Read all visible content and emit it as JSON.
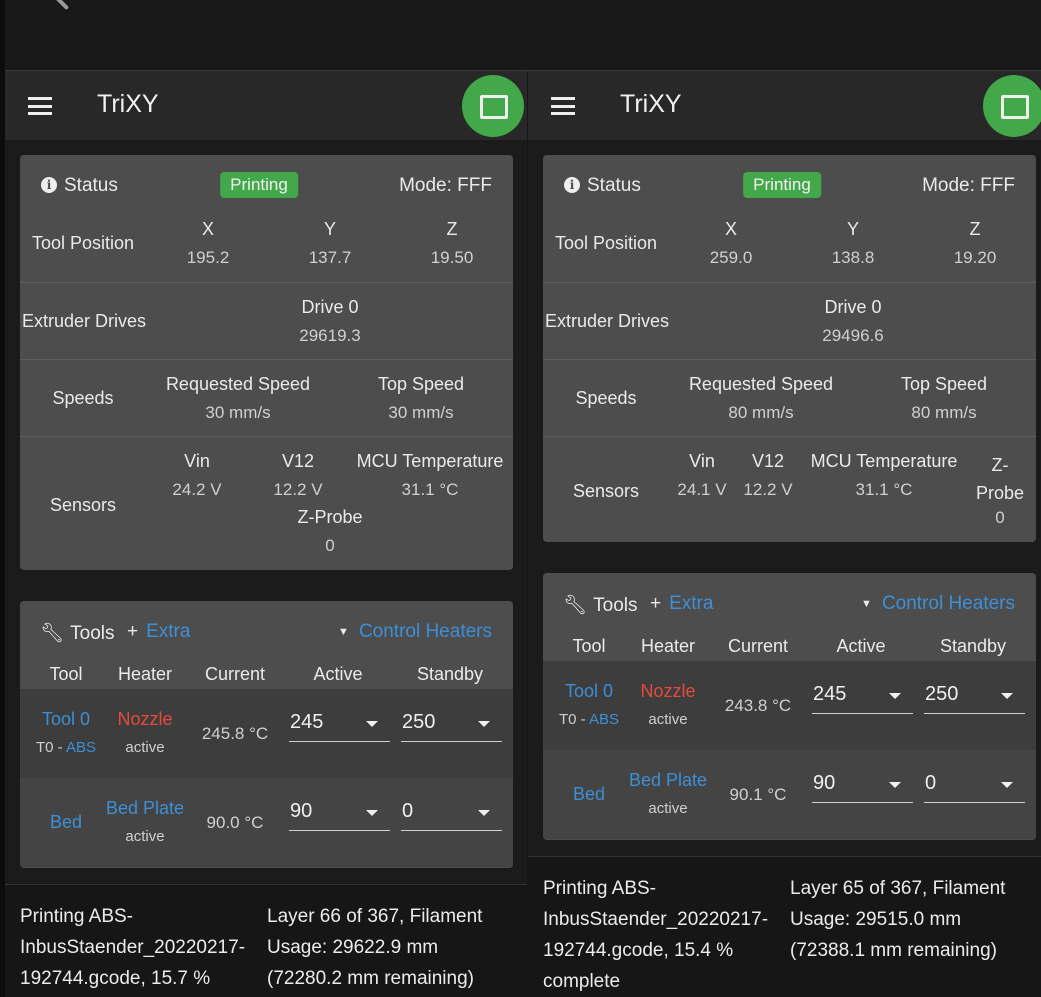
{
  "colors": {
    "accent_green": "#43a84a",
    "link_blue": "#3d8fd6",
    "heater_red": "#e54a3d"
  },
  "icons": {
    "menu": "hamburger-icon",
    "fab": "fullscreen-icon",
    "status": "info-icon",
    "tools": "wrench-icon",
    "extra": "plus-icon",
    "control": "caret-down-icon"
  },
  "screens": [
    {
      "app_title": "TriXY",
      "status": {
        "title": "Status",
        "badge": "Printing",
        "mode": "Mode: FFF",
        "tool_position": {
          "label": "Tool Position",
          "axes": [
            {
              "name": "X",
              "value": "195.2"
            },
            {
              "name": "Y",
              "value": "137.7"
            },
            {
              "name": "Z",
              "value": "19.50"
            }
          ]
        },
        "extruder": {
          "label": "Extruder Drives",
          "drive": "Drive 0",
          "value": "29619.3"
        },
        "speeds": {
          "label": "Speeds",
          "requested_label": "Requested Speed",
          "requested": "30 mm/s",
          "top_label": "Top Speed",
          "top": "30 mm/s"
        },
        "sensors": {
          "label": "Sensors",
          "items": [
            {
              "name": "Vin",
              "value": "24.2 V"
            },
            {
              "name": "V12",
              "value": "12.2 V"
            },
            {
              "name": "MCU Temperature",
              "value": "31.1 °C"
            },
            {
              "name": "Z-Probe",
              "value": "0"
            }
          ]
        }
      },
      "tools": {
        "title": "Tools",
        "extra": "Extra",
        "control": "Control Heaters",
        "headers": [
          "Tool",
          "Heater",
          "Current",
          "Active",
          "Standby"
        ],
        "rows": [
          {
            "tool": "Tool 0",
            "sub_prefix": "T0 - ",
            "sub_link": "ABS",
            "heater": "Nozzle",
            "heater_state": "active",
            "current": "245.8 °C",
            "active": "245",
            "standby": "250"
          },
          {
            "tool": "Bed",
            "sub_prefix": "",
            "sub_link": "",
            "heater": "Bed Plate",
            "heater_state": "active",
            "current": "90.0 °C",
            "active": "90",
            "standby": "0"
          }
        ]
      },
      "footer": {
        "job": "Printing ABS-InbusStaender_20220217-192744.gcode, 15.7 %",
        "progress": "Layer 66 of 367, Filament Usage: 29622.9 mm (72280.2 mm remaining)"
      }
    },
    {
      "app_title": "TriXY",
      "status": {
        "title": "Status",
        "badge": "Printing",
        "mode": "Mode: FFF",
        "tool_position": {
          "label": "Tool Position",
          "axes": [
            {
              "name": "X",
              "value": "259.0"
            },
            {
              "name": "Y",
              "value": "138.8"
            },
            {
              "name": "Z",
              "value": "19.20"
            }
          ]
        },
        "extruder": {
          "label": "Extruder Drives",
          "drive": "Drive 0",
          "value": "29496.6"
        },
        "speeds": {
          "label": "Speeds",
          "requested_label": "Requested Speed",
          "requested": "80 mm/s",
          "top_label": "Top Speed",
          "top": "80 mm/s"
        },
        "sensors": {
          "label": "Sensors",
          "items": [
            {
              "name": "Vin",
              "value": "24.1 V"
            },
            {
              "name": "V12",
              "value": "12.2 V"
            },
            {
              "name": "MCU Temperature",
              "value": "31.1 °C"
            },
            {
              "name": "Z-Probe",
              "value": "0"
            }
          ]
        }
      },
      "tools": {
        "title": "Tools",
        "extra": "Extra",
        "control": "Control Heaters",
        "headers": [
          "Tool",
          "Heater",
          "Current",
          "Active",
          "Standby"
        ],
        "rows": [
          {
            "tool": "Tool 0",
            "sub_prefix": "T0 - ",
            "sub_link": "ABS",
            "heater": "Nozzle",
            "heater_state": "active",
            "current": "243.8 °C",
            "active": "245",
            "standby": "250"
          },
          {
            "tool": "Bed",
            "sub_prefix": "",
            "sub_link": "",
            "heater": "Bed Plate",
            "heater_state": "active",
            "current": "90.1 °C",
            "active": "90",
            "standby": "0"
          }
        ]
      },
      "footer": {
        "job": "Printing ABS-InbusStaender_20220217-192744.gcode, 15.4 % complete",
        "progress": "Layer 65 of 367, Filament Usage: 29515.0 mm (72388.1 mm remaining)"
      }
    }
  ]
}
